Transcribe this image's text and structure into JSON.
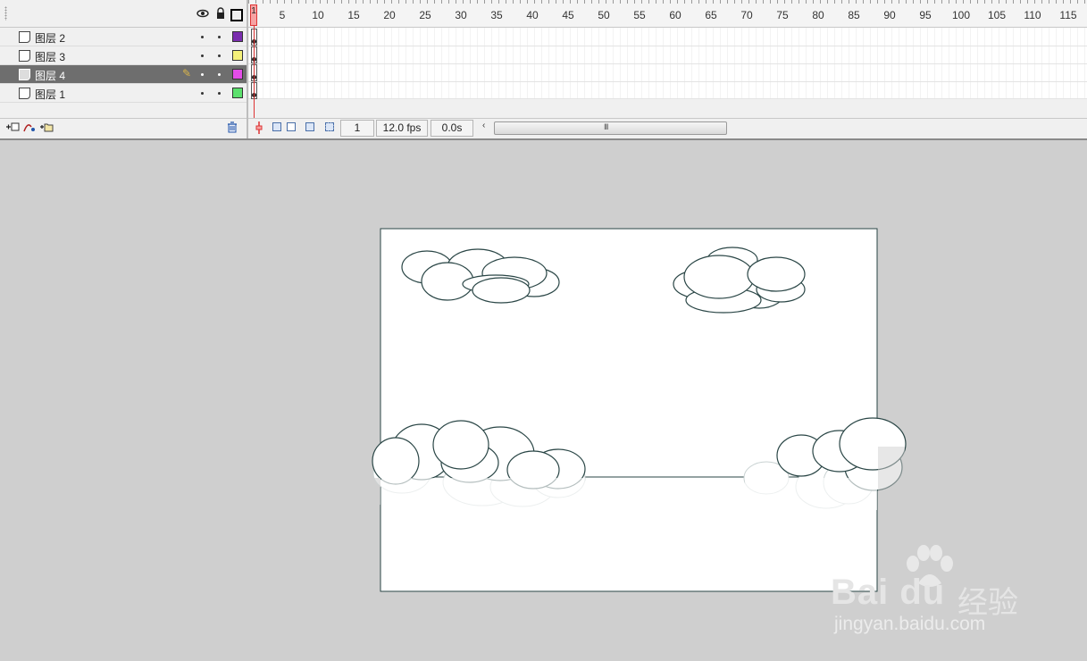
{
  "timeline": {
    "header_icons": [
      "eye-icon",
      "lock-icon",
      "outline-icon"
    ],
    "layers": [
      {
        "name": "图层 2",
        "color": "#7a2dae",
        "selected": false,
        "keyframe": true
      },
      {
        "name": "图层 3",
        "color": "#f4f07a",
        "selected": false,
        "keyframe": true
      },
      {
        "name": "图层 4",
        "color": "#e34de8",
        "selected": true,
        "keyframe": true
      },
      {
        "name": "图层 1",
        "color": "#5ce06d",
        "selected": false,
        "keyframe": true
      }
    ],
    "ruler": [
      "1",
      "5",
      "10",
      "15",
      "20",
      "25",
      "30",
      "35",
      "40",
      "45",
      "50",
      "55",
      "60",
      "65",
      "70",
      "75",
      "80",
      "85",
      "90",
      "95",
      "100",
      "105",
      "110",
      "115"
    ],
    "playhead_frame": "1",
    "status": {
      "current_frame": "1",
      "frame_rate": "12.0 fps",
      "elapsed_time": "0.0s",
      "scroll_arrow": "‹",
      "scroll_grip": "III"
    },
    "tool_icons": [
      "add-layer-icon",
      "add-motion-guide-icon",
      "add-folder-icon",
      "delete-layer-icon"
    ]
  },
  "stage": {
    "background": "#ffffff",
    "stroke": "#2a4646"
  },
  "watermark": {
    "logo": "Bai du",
    "product": "经验",
    "url": "jingyan.baidu.com"
  }
}
